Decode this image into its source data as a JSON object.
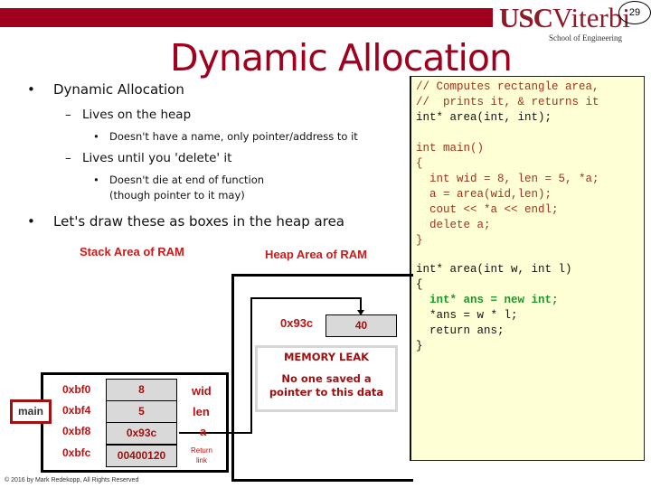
{
  "header": {
    "logo_usc": "USC",
    "logo_viterbi": "Viterbi",
    "logo_subtitle": "School of Engineering",
    "page_number": "29",
    "brand_color": "#a0001e"
  },
  "slide": {
    "title": "Dynamic Allocation",
    "bullets": [
      {
        "level": 1,
        "text": "Dynamic Allocation"
      },
      {
        "level": 2,
        "text": "Lives on the heap"
      },
      {
        "level": 3,
        "text": "Doesn't have a name, only pointer/address to it"
      },
      {
        "level": 2,
        "text": "Lives until you 'delete' it"
      },
      {
        "level": 3,
        "text": "Doesn't die at end of function"
      },
      {
        "level": 3,
        "text": "(though pointer to it may)"
      },
      {
        "level": 1,
        "text": "Let's draw these as boxes in the heap area"
      }
    ],
    "bullet_glyph": "•",
    "dash_glyph": "–"
  },
  "code": {
    "lines": [
      "// Computes rectangle area,",
      "//  prints it, & returns it",
      "int* area(int, int);",
      "",
      "int main()",
      "{",
      "  int wid = 8, len = 5, *a;",
      "  a = area(wid,len);",
      "  cout << *a << endl;",
      "  delete a;",
      "}",
      "",
      "int* area(int w, int l)",
      "{",
      "  int* ans = new int;",
      "  *ans = w * l;",
      "  return ans;",
      "}"
    ]
  },
  "diagram": {
    "stack_label": "Stack Area of RAM",
    "heap_label": "Heap Area of RAM",
    "frame_label": "main",
    "stack_rows": [
      {
        "addr": "0xbf0",
        "value": "8",
        "name": "wid"
      },
      {
        "addr": "0xbf4",
        "value": "5",
        "name": "len"
      },
      {
        "addr": "0xbf8",
        "value": "0x93c",
        "name": "a"
      },
      {
        "addr": "0xbfc",
        "value": "00400120",
        "name": "Return link"
      }
    ],
    "heap_cell": {
      "addr": "0x93c",
      "value": "40"
    },
    "leak_title": "MEMORY LEAK",
    "leak_text": "No one saved a pointer to this data"
  },
  "footer": {
    "copyright": "© 2016 by Mark Redekopp, All Rights Reserved"
  }
}
